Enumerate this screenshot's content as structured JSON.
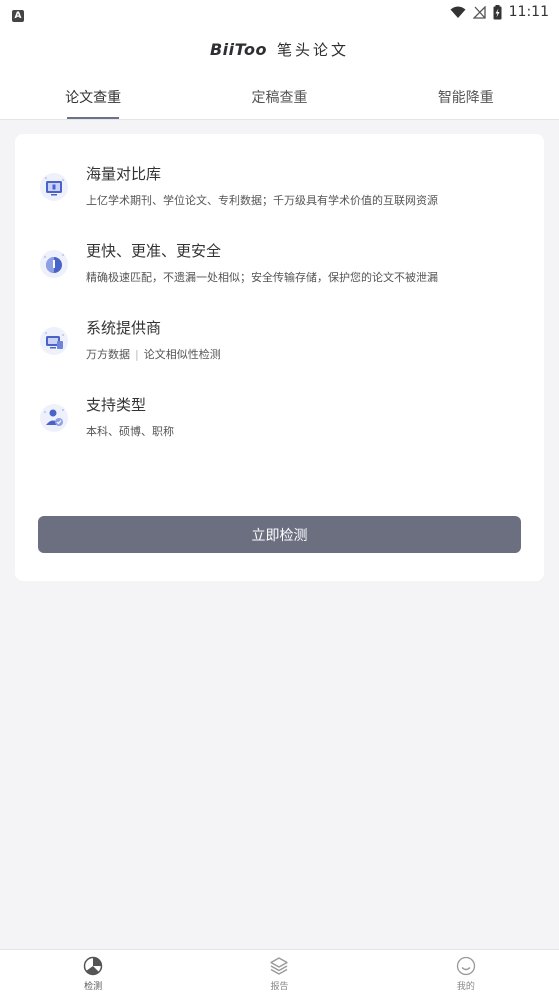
{
  "status_bar": {
    "notification_icon": "A",
    "time": "11:11"
  },
  "header": {
    "brand_en": "BiiToo",
    "brand_cn": "笔头论文"
  },
  "tabs": [
    {
      "label": "论文查重",
      "active": true
    },
    {
      "label": "定稿查重",
      "active": false
    },
    {
      "label": "智能降重",
      "active": false
    }
  ],
  "features": [
    {
      "title": "海量对比库",
      "desc": "上亿学术期刊、学位论文、专利数据；千万级具有学术价值的互联网资源",
      "icon": "database-icon"
    },
    {
      "title": "更快、更准、更安全",
      "desc": "精确极速匹配，不遗漏一处相似；安全传输存储，保护您的论文不被泄漏",
      "icon": "shield-icon"
    },
    {
      "title": "系统提供商",
      "desc_part1": "万方数据",
      "desc_sep": "|",
      "desc_part2": "论文相似性检测",
      "icon": "system-icon"
    },
    {
      "title": "支持类型",
      "desc": "本科、硕博、职称",
      "icon": "user-type-icon"
    }
  ],
  "cta": {
    "label": "立即检测"
  },
  "bottom_nav": [
    {
      "label": "检测",
      "icon": "pie-chart-icon",
      "active": true
    },
    {
      "label": "报告",
      "icon": "layers-icon",
      "active": false
    },
    {
      "label": "我的",
      "icon": "smile-icon",
      "active": false
    }
  ],
  "colors": {
    "accent": "#6b6f80",
    "icon_blue": "#4a63c8",
    "background": "#f4f4f6"
  }
}
